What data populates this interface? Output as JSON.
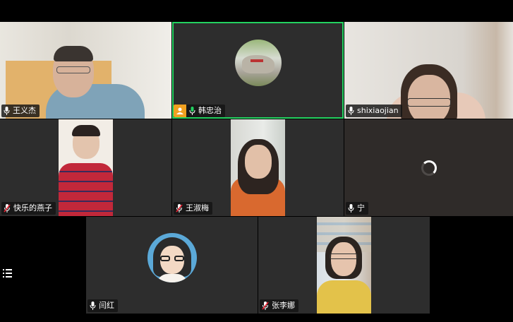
{
  "participants": [
    {
      "id": "p1",
      "name": "王义杰",
      "mic": "on"
    },
    {
      "id": "p2",
      "name": "韩忠治",
      "mic": "speaking",
      "host": true,
      "active": true
    },
    {
      "id": "p3",
      "name": "shixiaojian",
      "mic": "on"
    },
    {
      "id": "p4",
      "name": "快乐的燕子",
      "mic": "muted"
    },
    {
      "id": "p5",
      "name": "王淑梅",
      "mic": "muted"
    },
    {
      "id": "p6",
      "name": "宁",
      "mic": "on",
      "loading": true
    },
    {
      "id": "p7",
      "name": "闫红",
      "mic": "on"
    },
    {
      "id": "p8",
      "name": "张李娜",
      "mic": "muted"
    }
  ],
  "colors": {
    "active_border": "#23d160",
    "host_badge": "#f0a020",
    "tile_bg": "#2d2d2d",
    "avatar_ring": "#5ba9d8"
  },
  "icons": {
    "menu": "hamburger-menu-icon",
    "mic": "microphone-icon",
    "mic_muted": "microphone-muted-icon",
    "host": "host-user-icon"
  }
}
